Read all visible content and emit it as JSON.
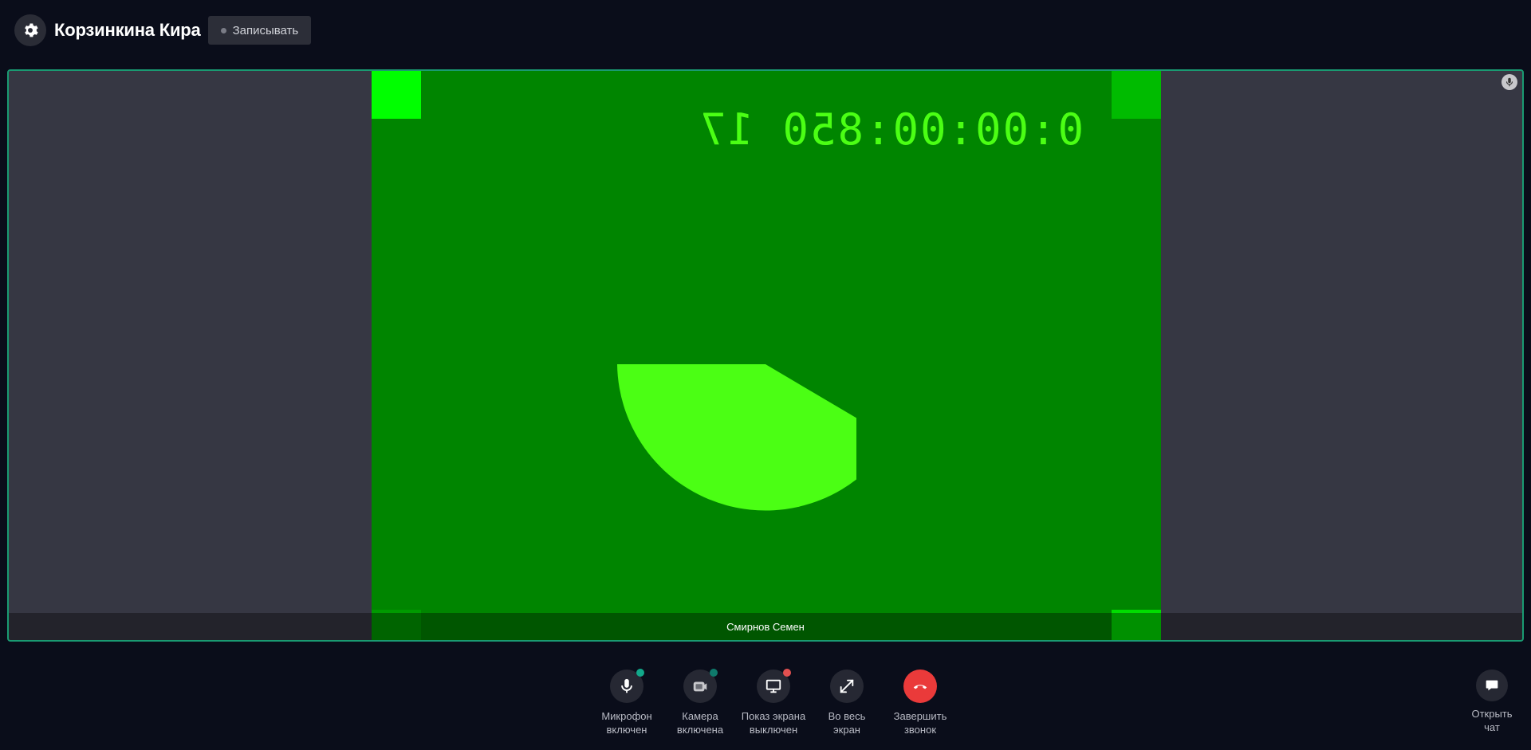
{
  "header": {
    "settings_icon": "gear-icon",
    "user_name": "Корзинкина Кира",
    "record_label": "Записывать"
  },
  "tile": {
    "participant_name": "Смирнов Семен",
    "timecode": "0:00:00:850 17",
    "mic_indicator_icon": "microphone-icon",
    "accent_color": "#1a9a72"
  },
  "controls": [
    {
      "label_line1": "Микрофон",
      "label_line2": "включен",
      "icon": "microphone-icon",
      "badge_color": "#12a88a"
    },
    {
      "label_line1": "Камера",
      "label_line2": "включена",
      "icon": "camera-icon",
      "badge_color": "#0f7a6c"
    },
    {
      "label_line1": "Показ экрана",
      "label_line2": "выключен",
      "icon": "monitor-icon",
      "badge_color": "#e25050"
    },
    {
      "label_line1": "Во весь",
      "label_line2": "экран",
      "icon": "expand-icon"
    },
    {
      "label_line1": "Завершить",
      "label_line2": "звонок",
      "icon": "hangup-icon",
      "color": "#ea3a3a"
    }
  ],
  "chat": {
    "label_line1": "Открыть",
    "label_line2": "чат",
    "icon": "chat-icon"
  }
}
